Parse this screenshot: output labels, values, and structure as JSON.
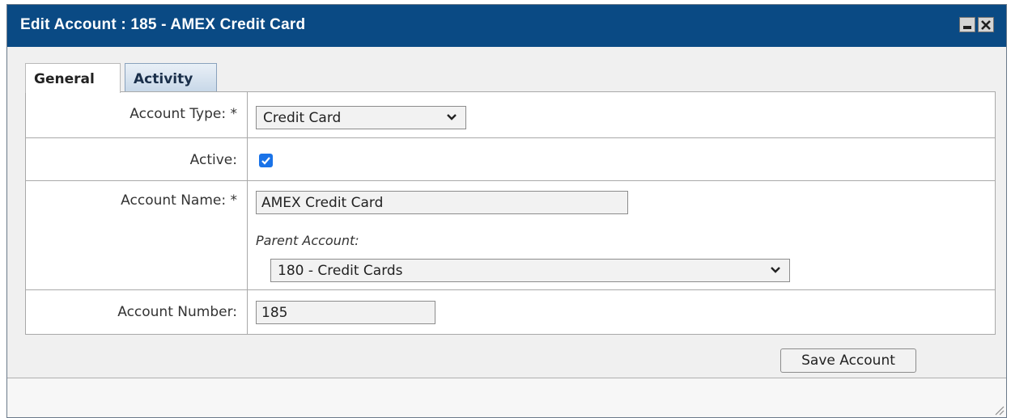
{
  "window": {
    "title": "Edit Account : 185 - AMEX Credit Card"
  },
  "tabs": [
    {
      "label": "General",
      "active": true
    },
    {
      "label": "Activity",
      "active": false
    }
  ],
  "form": {
    "account_type": {
      "label": "Account Type: *",
      "value": "Credit Card"
    },
    "active": {
      "label": "Active:",
      "checked": true
    },
    "account_name": {
      "label": "Account Name: *",
      "value": "AMEX Credit Card"
    },
    "parent_account": {
      "label": "Parent Account:",
      "value": "180 - Credit Cards"
    },
    "account_number": {
      "label": "Account Number:",
      "value": "185"
    }
  },
  "actions": {
    "save_label": "Save Account"
  },
  "colors": {
    "titlebar": "#0a4a84",
    "checkbox": "#1a73e8"
  }
}
